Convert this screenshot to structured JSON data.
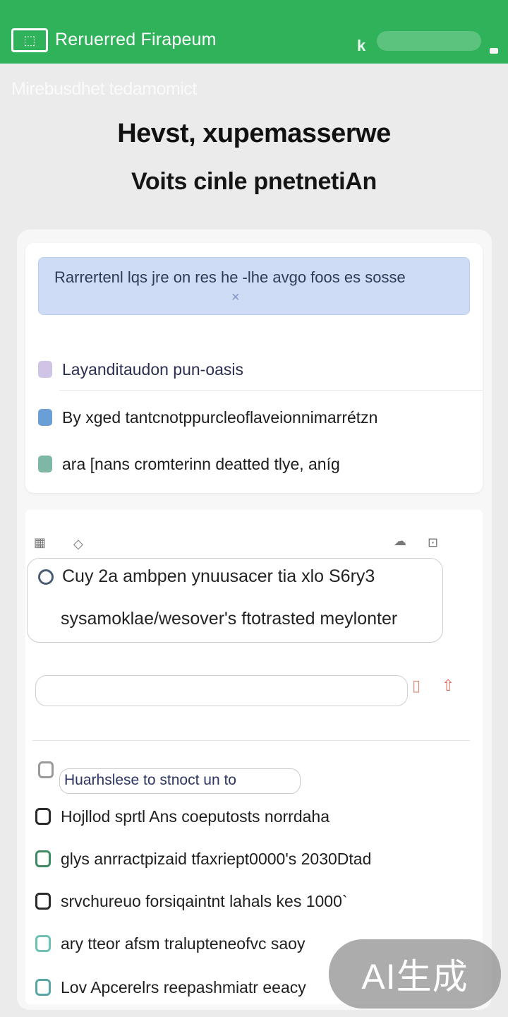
{
  "header": {
    "app_icon_glyph": "⬚",
    "title": "Reruerred  Firapeum",
    "chevron": "k",
    "accent": "#2fb25a"
  },
  "watermark_line": "Mirebusdhet tedamomict",
  "hero": {
    "title": "Hevst, xupemasserwe",
    "subtitle": "Voits cinle pnetnetiAn"
  },
  "card1": {
    "banner_text": "Rarrertenl lqs jre on res he -lhe avgo foos es sosse",
    "banner_close": "×",
    "section_heading": "Layanditaudon pun-oasis",
    "rows": [
      "By  xged tantcnotppurcleoflaveionnimarrétzn",
      "ara [nans cromterinn deatted tlye, aníg"
    ]
  },
  "card2": {
    "quote_lines": [
      "Cuy  2a ambpen ynuusacer tia xlo S6ry3",
      "sysamoklae/wesover's ftotrasted meylonter"
    ],
    "search_text": "Huarhslese  to  stnoct un to",
    "list_rows": [
      "Hojllod sprtl Ans coeputosts norrdaha",
      "glys  anrractpizaid tfaxriept0000's 2030Dtad",
      "srvchureuo forsiqaintnt lahals kes 1000`",
      "ary  tteor afsm tralupteneofvc saoy",
      "Lov Apcerelrs reepashmiatr eeacy"
    ]
  },
  "badge": "AI生成"
}
